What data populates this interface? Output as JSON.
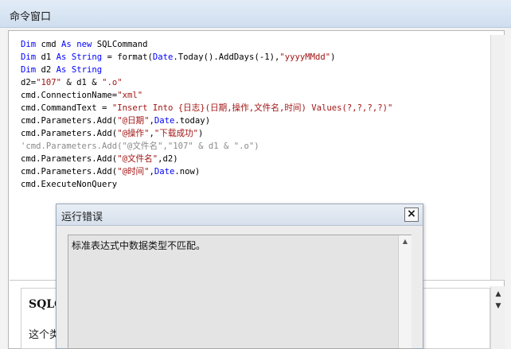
{
  "window": {
    "title": "命令窗口"
  },
  "code_lines": [
    [
      {
        "t": "Dim",
        "c": "kw"
      },
      {
        "t": " cmd ",
        "c": ""
      },
      {
        "t": "As",
        "c": "kw"
      },
      {
        "t": " ",
        "c": ""
      },
      {
        "t": "new",
        "c": "kw"
      },
      {
        "t": " SQLCommand",
        "c": ""
      }
    ],
    [
      {
        "t": "Dim",
        "c": "kw"
      },
      {
        "t": " d1 ",
        "c": ""
      },
      {
        "t": "As",
        "c": "kw"
      },
      {
        "t": " ",
        "c": ""
      },
      {
        "t": "String",
        "c": "kw"
      },
      {
        "t": " = format(",
        "c": ""
      },
      {
        "t": "Date",
        "c": "kw"
      },
      {
        "t": ".Today().AddDays(-1),",
        "c": ""
      },
      {
        "t": "\"yyyyMMdd\"",
        "c": "str"
      },
      {
        "t": ")",
        "c": ""
      }
    ],
    [
      {
        "t": "Dim",
        "c": "kw"
      },
      {
        "t": " d2 ",
        "c": ""
      },
      {
        "t": "As",
        "c": "kw"
      },
      {
        "t": " ",
        "c": ""
      },
      {
        "t": "String",
        "c": "kw"
      }
    ],
    [
      {
        "t": "d2=",
        "c": ""
      },
      {
        "t": "\"107\"",
        "c": "str"
      },
      {
        "t": " & d1 & ",
        "c": ""
      },
      {
        "t": "\".o\"",
        "c": "str"
      }
    ],
    [
      {
        "t": "cmd.ConnectionName=",
        "c": ""
      },
      {
        "t": "\"xml\"",
        "c": "str"
      }
    ],
    [
      {
        "t": "cmd.CommandText = ",
        "c": ""
      },
      {
        "t": "\"Insert Into {日志}(日期,操作,文件名,时间) Values(?,?,?,?)\"",
        "c": "str"
      }
    ],
    [
      {
        "t": "cmd.Parameters.Add(",
        "c": ""
      },
      {
        "t": "\"@日期\"",
        "c": "str"
      },
      {
        "t": ",",
        "c": ""
      },
      {
        "t": "Date",
        "c": "kw"
      },
      {
        "t": ".today)",
        "c": ""
      }
    ],
    [
      {
        "t": "cmd.Parameters.Add(",
        "c": ""
      },
      {
        "t": "\"@操作\"",
        "c": "str"
      },
      {
        "t": ",",
        "c": ""
      },
      {
        "t": "\"下载成功\"",
        "c": "str"
      },
      {
        "t": ")",
        "c": ""
      }
    ],
    [
      {
        "t": "'cmd.Parameters.Add(\"@文件名\",\"107\" & d1 & \".o\")",
        "c": "cmt"
      }
    ],
    [
      {
        "t": "cmd.Parameters.Add(",
        "c": ""
      },
      {
        "t": "\"@文件名\"",
        "c": "str"
      },
      {
        "t": ",d2)",
        "c": ""
      }
    ],
    [
      {
        "t": "cmd.Parameters.Add(",
        "c": ""
      },
      {
        "t": "\"@时间\"",
        "c": "str"
      },
      {
        "t": ",",
        "c": ""
      },
      {
        "t": "Date",
        "c": "kw"
      },
      {
        "t": ".now)",
        "c": ""
      }
    ],
    [
      {
        "t": "cmd.ExecuteNonQuery",
        "c": ""
      }
    ]
  ],
  "help": {
    "title": "SQLC",
    "text": "这个类"
  },
  "dialog": {
    "title": "运行错误",
    "close_label": "×",
    "message": "标准表达式中数据类型不匹配。"
  },
  "icons": {
    "scroll_up": "▲",
    "scroll_down": "▼"
  }
}
